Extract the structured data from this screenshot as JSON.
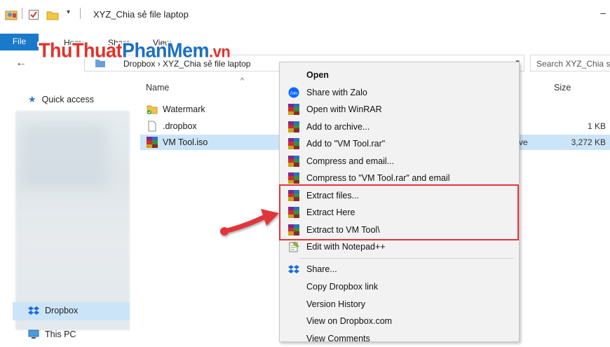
{
  "window": {
    "title": "XYZ_Chia sẻ file laptop",
    "minimize_glyph": "–"
  },
  "ribbon": {
    "tabs": [
      "File",
      "Home",
      "Share",
      "View"
    ]
  },
  "watermark": {
    "part1": "ThuThuat",
    "part2": "PhanMem",
    "part3": ".vn"
  },
  "navigation": {
    "address_path": "Dropbox  ›  XYZ_Chia sẻ file laptop",
    "search_placeholder": "Search XYZ_Chia se"
  },
  "sidebar": {
    "items": [
      {
        "label": "Quick access",
        "icon": "star-icon"
      },
      {
        "label": "Dropbox",
        "icon": "dropbox-icon",
        "selected": true
      },
      {
        "label": "This PC",
        "icon": "monitor-icon"
      }
    ]
  },
  "file_list": {
    "columns": {
      "name": "Name",
      "size": "Size"
    },
    "rows": [
      {
        "name": "Watermark",
        "icon": "folder-icon",
        "size": ""
      },
      {
        "name": ".dropbox",
        "icon": "file-icon",
        "size": "1 KB"
      },
      {
        "name": "VM Tool.iso",
        "icon": "winrar-icon",
        "size": "3,272 KB",
        "type_fragment": "ve",
        "selected": true
      }
    ]
  },
  "context_menu": {
    "items": [
      {
        "label": "Open",
        "bold": true,
        "icon": ""
      },
      {
        "label": "Share with Zalo",
        "icon": "zalo-icon"
      },
      {
        "label": "Open with WinRAR",
        "icon": "winrar-icon"
      },
      {
        "label": "Add to archive...",
        "icon": "winrar-icon"
      },
      {
        "label": "Add to \"VM Tool.rar\"",
        "icon": "winrar-icon"
      },
      {
        "label": "Compress and email...",
        "icon": "winrar-icon"
      },
      {
        "label": "Compress to \"VM Tool.rar\" and email",
        "icon": "winrar-icon"
      },
      {
        "label": "Extract files...",
        "icon": "winrar-icon",
        "highlighted": true
      },
      {
        "label": "Extract Here",
        "icon": "winrar-icon",
        "highlighted": true
      },
      {
        "label": "Extract to VM Tool\\",
        "icon": "winrar-icon",
        "highlighted": true
      },
      {
        "label": "Edit with Notepad++",
        "icon": "notepad-plus-plus-icon"
      },
      {
        "label": "Share...",
        "icon": "dropbox-icon"
      },
      {
        "label": "Copy Dropbox link",
        "icon": ""
      },
      {
        "label": "Version History",
        "icon": ""
      },
      {
        "label": "View on Dropbox.com",
        "icon": ""
      },
      {
        "label": "View Comments",
        "icon": ""
      }
    ]
  },
  "colors": {
    "accent": "#1979ca",
    "selection": "#cce4f7",
    "highlight_box": "#e2363b",
    "watermark_red": "#e0322a",
    "watermark_blue": "#1c6fc4"
  }
}
